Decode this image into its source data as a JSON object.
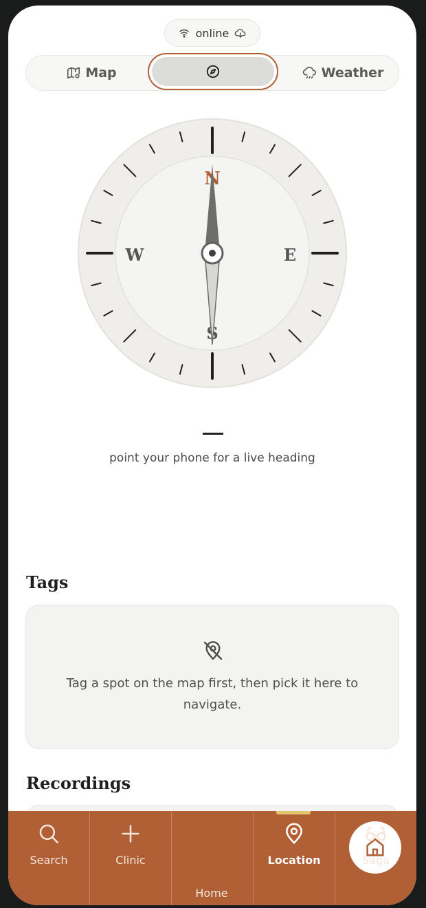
{
  "status": {
    "text": "online",
    "wifi_icon": "wifi-icon",
    "sync_icon": "cloud-download-icon"
  },
  "tabs": {
    "map": {
      "label": "Map",
      "icon": "map-icon"
    },
    "compass": {
      "label": "",
      "icon": "compass-icon",
      "selected": true
    },
    "weather": {
      "label": "Weather",
      "icon": "cloud-rain-icon"
    }
  },
  "compass": {
    "north": "N",
    "east": "E",
    "south": "S",
    "west": "W",
    "heading_value": "—",
    "hint": "point your phone for a live heading",
    "accent": "#b15f35"
  },
  "tags": {
    "title": "Tags",
    "empty_icon": "location-off-icon",
    "empty_message": "Tag a spot on the map first, then pick it here to navigate."
  },
  "recordings": {
    "title": "Recordings"
  },
  "nav": {
    "items": [
      {
        "label": "Search",
        "icon": "search-icon"
      },
      {
        "label": "Clinic",
        "icon": "plus-icon"
      },
      {
        "label": "Home",
        "icon": "home-icon"
      },
      {
        "label": "Location",
        "icon": "location-pin-icon",
        "active": true
      },
      {
        "label": "Saga",
        "icon": "glasses-icon"
      }
    ],
    "background": "#b15f35",
    "active_indicator": "#e2c66d"
  }
}
